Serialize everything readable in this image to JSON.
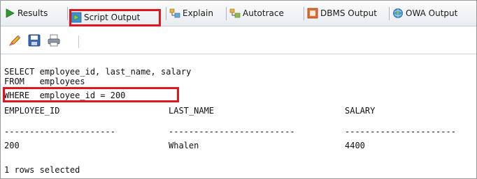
{
  "tabs": [
    {
      "label": "Results",
      "icon": "run-triangle-icon"
    },
    {
      "label": "Script Output",
      "icon": "script-output-icon",
      "selected": true
    },
    {
      "label": "Explain",
      "icon": "explain-plan-icon"
    },
    {
      "label": "Autotrace",
      "icon": "autotrace-icon"
    },
    {
      "label": "DBMS Output",
      "icon": "dbms-output-icon"
    },
    {
      "label": "OWA Output",
      "icon": "owa-globe-icon"
    }
  ],
  "toolbar": {
    "icons": [
      "eraser-pencil-icon",
      "save-disk-icon",
      "print-icon"
    ]
  },
  "output": {
    "sql_lines": [
      "SELECT employee_id, last_name, salary",
      "FROM   employees",
      "WHERE  employee_id = 200"
    ],
    "columns": [
      "EMPLOYEE_ID",
      "LAST_NAME",
      "SALARY"
    ],
    "separators": [
      "----------------------",
      "-------------------------",
      "----------------------"
    ],
    "rows": [
      [
        "200",
        "Whalen",
        "4400"
      ]
    ],
    "footer": "1 rows selected"
  },
  "colors": {
    "highlight": "#e0161c",
    "tab_bar_bg": "#e9ecf1"
  }
}
